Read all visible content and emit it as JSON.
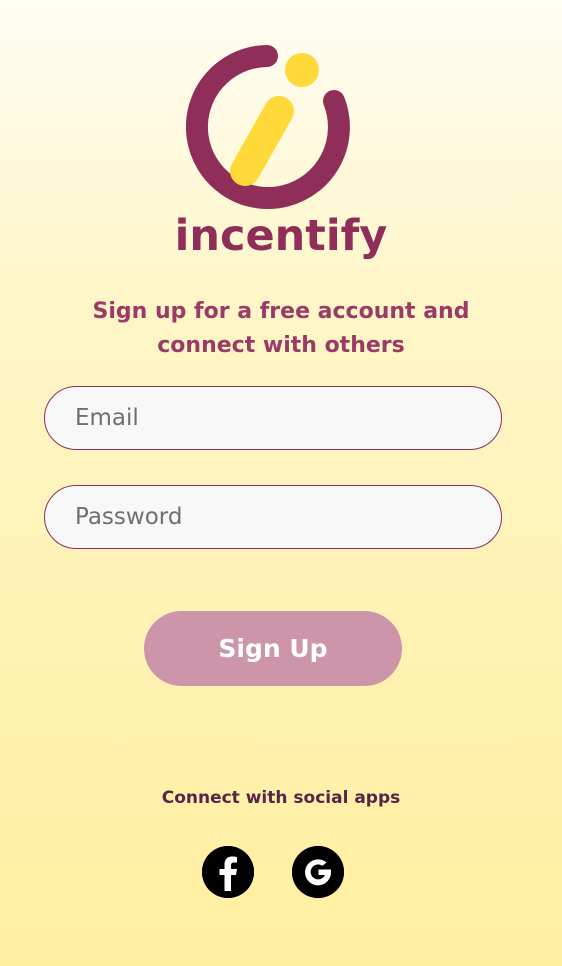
{
  "brand": {
    "name": "incentify",
    "logo_icon": "incentify-logo-icon",
    "colors": {
      "primary": "#8f2f59",
      "accent": "#ffd93a",
      "button": "#cd95a9"
    }
  },
  "signup": {
    "tagline": "Sign up for a free account and connect with others",
    "email_placeholder": "Email",
    "password_placeholder": "Password",
    "submit_label": "Sign Up"
  },
  "social": {
    "label": "Connect with social apps",
    "apps": [
      {
        "name": "facebook",
        "icon": "facebook-icon"
      },
      {
        "name": "google",
        "icon": "google-icon"
      }
    ]
  }
}
